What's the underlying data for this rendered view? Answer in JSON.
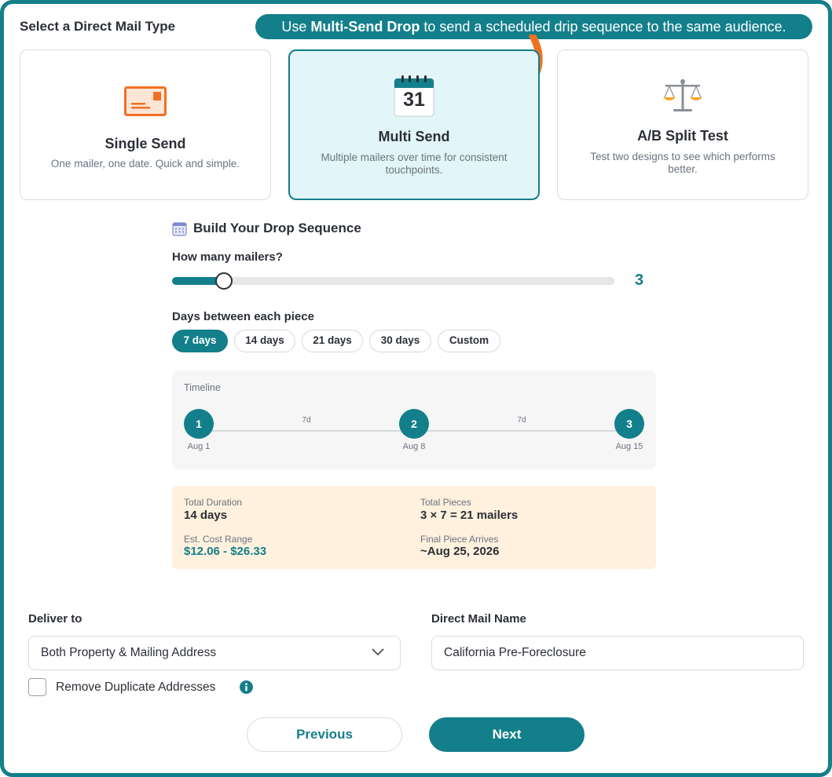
{
  "header": {
    "title": "Select a Direct Mail Type"
  },
  "callout": {
    "prefix": "Use ",
    "highlight": "Multi-Send Drop",
    "suffix": " to send a scheduled drip sequence to the same audience."
  },
  "cards": [
    {
      "title": "Single Send",
      "desc": "One mailer, one date. Quick and simple.",
      "icon": "envelope-icon",
      "selected": false
    },
    {
      "title": "Multi Send",
      "desc": "Multiple mailers over time for consistent touchpoints.",
      "icon": "calendar-icon",
      "icon_text": "31",
      "selected": true
    },
    {
      "title": "A/B Split Test",
      "desc": "Test two designs to see which performs better.",
      "icon": "scale-icon",
      "selected": false
    }
  ],
  "sequence": {
    "title": "Build Your Drop Sequence",
    "mailers_label": "How many mailers?",
    "mailers_value": "3",
    "mailers_fraction": 0.117,
    "days_label": "Days between each piece",
    "day_options": [
      "7 days",
      "14 days",
      "21 days",
      "30 days",
      "Custom"
    ],
    "selected_day_option": "7 days"
  },
  "timeline": {
    "label": "Timeline",
    "nodes": [
      {
        "number": "1",
        "date": "Aug 1"
      },
      {
        "number": "2",
        "date": "Aug 8"
      },
      {
        "number": "3",
        "date": "Aug 15"
      }
    ],
    "gaps": [
      "7d",
      "7d"
    ]
  },
  "summary": {
    "duration_label": "Total Duration",
    "duration_value": "14 days",
    "pieces_label": "Total Pieces",
    "pieces_value": "3 × 7 = 21 mailers",
    "cost_label": "Est. Cost Range",
    "cost_value": "$12.06 - $26.33",
    "arrives_label": "Final Piece Arrives",
    "arrives_value": "~Aug 25, 2026"
  },
  "delivery": {
    "deliver_label": "Deliver to",
    "deliver_value": "Both Property & Mailing Address",
    "name_label": "Direct Mail Name",
    "name_value": "California Pre-Foreclosure",
    "dedupe_label": "Remove Duplicate Addresses",
    "dedupe_checked": false
  },
  "buttons": {
    "previous": "Previous",
    "next": "Next"
  },
  "colors": {
    "accent": "#137f8a",
    "arrow": "#f07022",
    "selected_card_bg": "#e2f5f8",
    "summary_bg": "#fff1de"
  }
}
